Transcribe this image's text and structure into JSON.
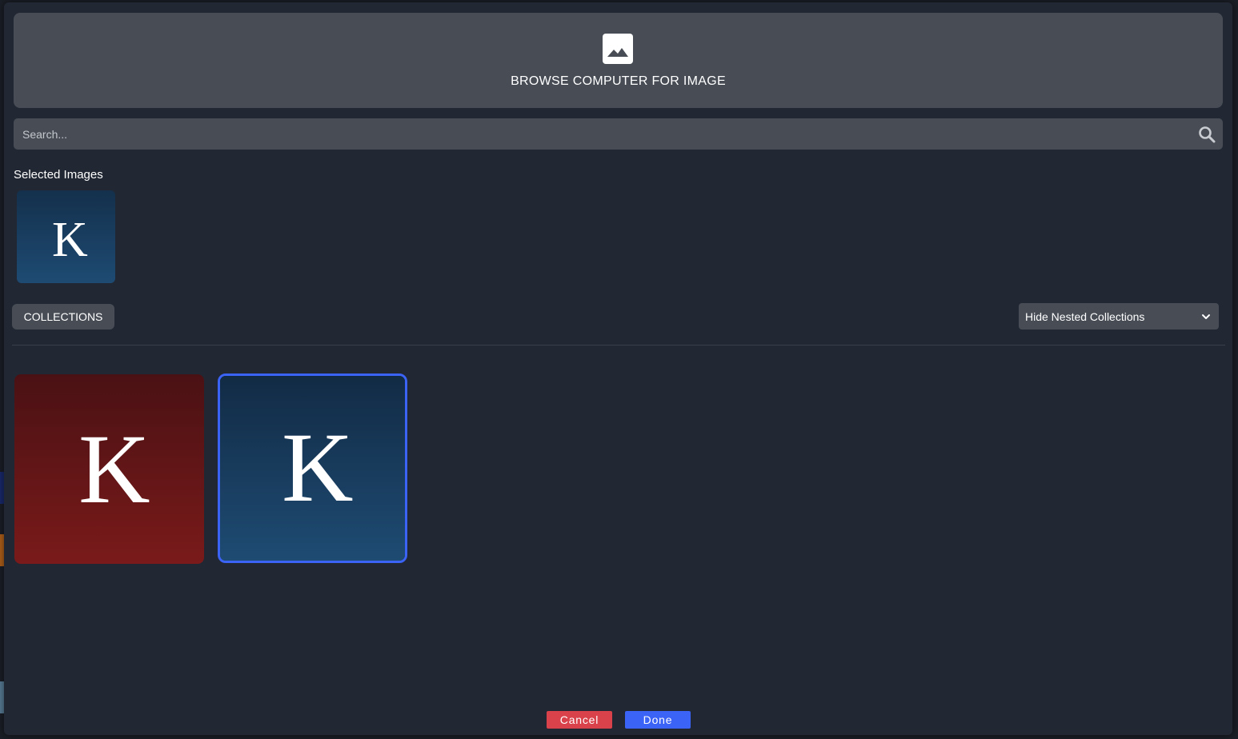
{
  "upload": {
    "label": "BROWSE COMPUTER FOR IMAGE",
    "icon": "image-icon"
  },
  "search": {
    "placeholder": "Search...",
    "value": "",
    "icon": "search-icon"
  },
  "selected": {
    "heading": "Selected Images",
    "images": [
      {
        "letter": "K",
        "background": "#1e4b73"
      }
    ]
  },
  "toolbar": {
    "collections_label": "COLLECTIONS",
    "nested_filter": "Hide Nested Collections"
  },
  "gallery": {
    "images": [
      {
        "letter": "K",
        "background": "#7a1a1a",
        "selected": false
      },
      {
        "letter": "K",
        "background": "#1e4b73",
        "selected": true
      }
    ]
  },
  "actions": {
    "cancel_label": "Cancel",
    "done_label": "Done"
  },
  "colors": {
    "cancel": "#d9424a",
    "done": "#3b63f5",
    "selection_border": "#3b63f5",
    "panel": "#474c55",
    "modal_bg": "#222833"
  }
}
